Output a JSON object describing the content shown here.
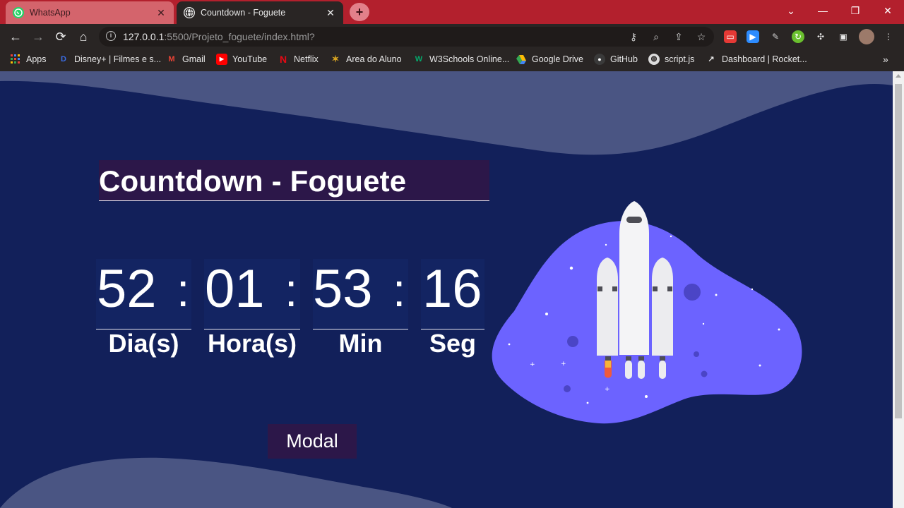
{
  "browser": {
    "tabs": [
      {
        "title": "WhatsApp"
      },
      {
        "title": "Countdown - Foguete"
      }
    ],
    "new_tab": "+",
    "url_host": "127.0.0.1",
    "url_rest": ":5500/Projeto_foguete/index.html?",
    "bookmarks": [
      {
        "label": "Apps",
        "icon": "apps-grid-icon"
      },
      {
        "label": "Disney+ | Filmes e s...",
        "icon": "disney-icon"
      },
      {
        "label": "Gmail",
        "icon": "gmail-icon"
      },
      {
        "label": "YouTube",
        "icon": "youtube-icon"
      },
      {
        "label": "Netflix",
        "icon": "netflix-icon"
      },
      {
        "label": "Area do Aluno",
        "icon": "star-icon"
      },
      {
        "label": "W3Schools Online...",
        "icon": "w3schools-icon"
      },
      {
        "label": "Google Drive",
        "icon": "google-drive-icon"
      },
      {
        "label": "GitHub",
        "icon": "github-icon"
      },
      {
        "label": "script.js",
        "icon": "globe-icon"
      },
      {
        "label": "Dashboard | Rocket...",
        "icon": "rocketseat-icon"
      }
    ]
  },
  "page": {
    "title": "Countdown - Foguete",
    "countdown": {
      "days": "52",
      "hours": "01",
      "minutes": "53",
      "seconds": "16",
      "separator": ":",
      "days_label": "Dia(s)",
      "hours_label": "Hora(s)",
      "minutes_label": "Min",
      "seconds_label": "Seg"
    },
    "modal_button": "Modal"
  },
  "colors": {
    "background": "#12205a",
    "wave": "#4a5583",
    "blob": "#6c63ff",
    "box": "#2c1749",
    "tabstrip": "#b3202d"
  }
}
